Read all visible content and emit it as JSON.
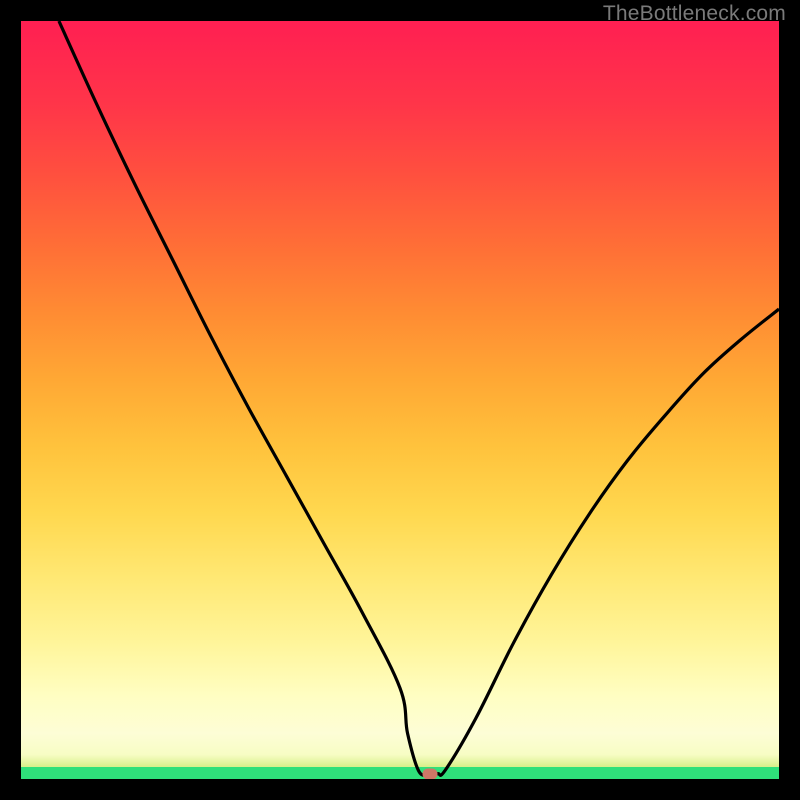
{
  "watermark": "TheBottleneck.com",
  "colors": {
    "frame": "#000000",
    "curve": "#000000",
    "marker": "#cc7766"
  },
  "chart_data": {
    "type": "line",
    "title": "",
    "xlabel": "",
    "ylabel": "",
    "xlim": [
      0,
      100
    ],
    "ylim": [
      0,
      100
    ],
    "grid": false,
    "series": [
      {
        "name": "bottleneck-curve",
        "x": [
          5,
          10,
          15,
          20,
          25,
          30,
          35,
          40,
          45,
          50,
          51,
          52.5,
          54,
          55,
          56,
          60,
          65,
          70,
          75,
          80,
          85,
          90,
          95,
          100
        ],
        "y": [
          100,
          89,
          78.5,
          68.5,
          58.5,
          49,
          40,
          31,
          22,
          12,
          6,
          1,
          0.7,
          0.7,
          1.2,
          8,
          18,
          27,
          35,
          42,
          48,
          53.5,
          58,
          62
        ]
      }
    ],
    "marker": {
      "x": 54,
      "y": 0.7
    },
    "background_gradient_stops": [
      {
        "pos": 0.0,
        "color": "#2fe07a"
      },
      {
        "pos": 0.016,
        "color": "#2fe07a"
      },
      {
        "pos": 0.032,
        "color": "#f7fdc4"
      },
      {
        "pos": 0.11,
        "color": "#fffec2"
      },
      {
        "pos": 0.26,
        "color": "#ffe976"
      },
      {
        "pos": 0.44,
        "color": "#ffc23c"
      },
      {
        "pos": 0.62,
        "color": "#ff8a33"
      },
      {
        "pos": 0.8,
        "color": "#ff4f3f"
      },
      {
        "pos": 1.0,
        "color": "#ff1f52"
      }
    ]
  }
}
